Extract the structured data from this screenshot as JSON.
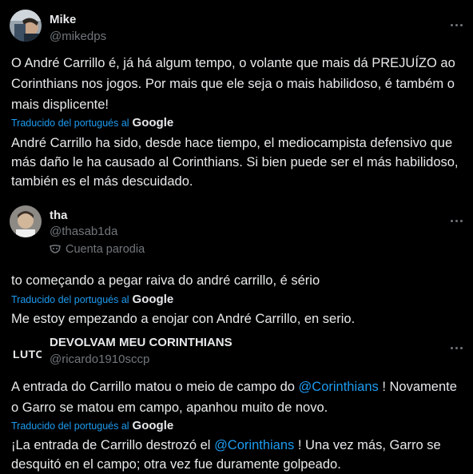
{
  "posts": [
    {
      "name": "Mike",
      "handle": "@mikedps",
      "text": "O André Carrillo é, já há algum tempo, o volante que mais dá PREJUÍZO ao Corinthians nos jogos. Por mais que ele seja o mais habilidoso, é também o mais displicente!",
      "translated_label": "Traducido del portugués al",
      "translated_brand": "Google",
      "translation": "André Carrillo ha sido, desde hace tiempo, el mediocampista defensivo que más daño le ha causado al Corinthians. Si bien puede ser el más habilidoso, también es el más descuidado."
    },
    {
      "name": "tha",
      "handle": "@thasab1da",
      "badge": "Cuenta parodia",
      "text": "to começando a pegar raiva do andré carrillo, é sério",
      "translated_label": "Traducido del portugués al",
      "translated_brand": "Google",
      "translation": "Me estoy empezando a enojar con André Carrillo, en serio."
    },
    {
      "name": "DEVOLVAM MEU CORINTHIANS",
      "handle": "@ricardo1910sccp",
      "avatar_text": "LUTO",
      "text_before": "A entrada do Carrillo matou o meio de campo do ",
      "mention": "@Corinthians",
      "text_after": " ! Novamente o Garro se matou em campo, apanhou muito de novo.",
      "translated_label": "Traducido del portugués al",
      "translated_brand": "Google",
      "translation_before": "¡La entrada de Carrillo destrozó el ",
      "translation_mention": "@Corinthians",
      "translation_after": " ! Una vez más, Garro se desquitó en el campo; otra vez fue duramente golpeado."
    }
  ]
}
